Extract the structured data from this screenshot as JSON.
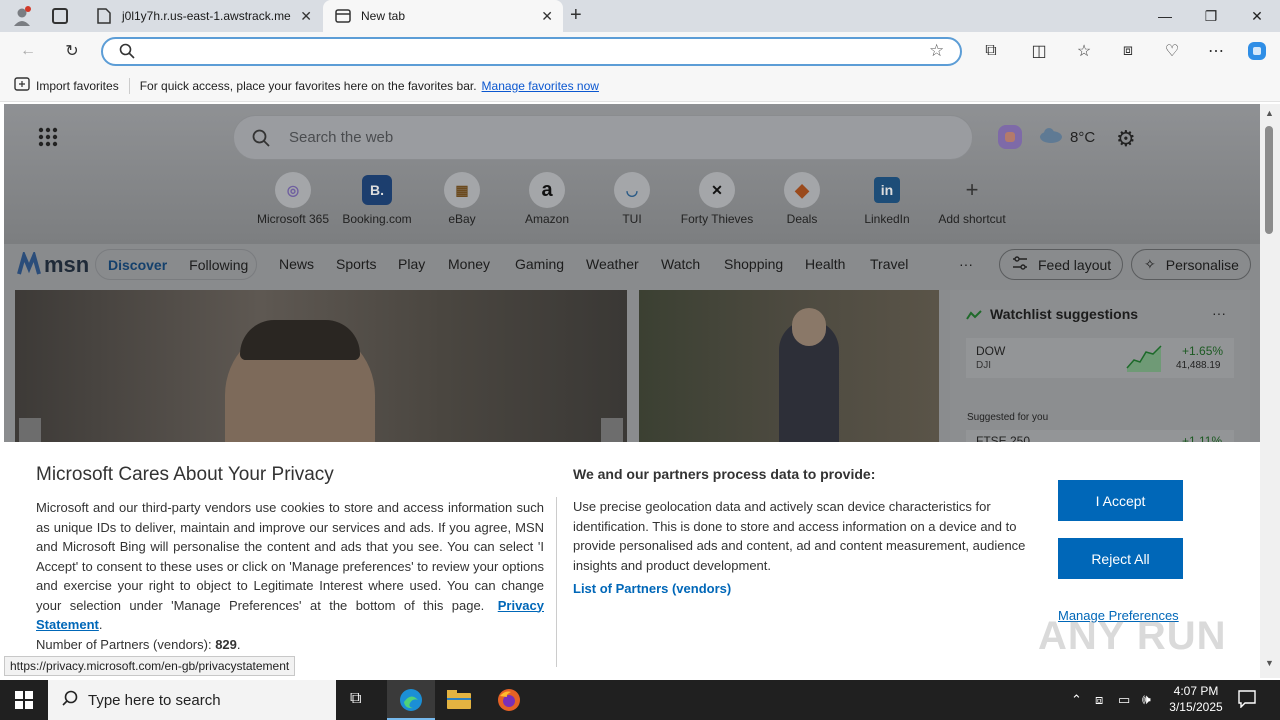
{
  "browser": {
    "tabs": [
      {
        "title": "j0l1y7h.r.us-east-1.awstrack.me",
        "active": false
      },
      {
        "title": "New tab",
        "active": true
      }
    ],
    "favorites_bar": {
      "import_label": "Import favorites",
      "message": "For quick access, place your favorites here on the favorites bar.",
      "manage_link": "Manage favorites now"
    }
  },
  "msn": {
    "search_placeholder": "Search the web",
    "weather_temp": "8°C",
    "shortcuts": [
      {
        "label": "Microsoft 365",
        "glyph": "◎"
      },
      {
        "label": "Booking.com",
        "glyph": "B."
      },
      {
        "label": "eBay",
        "glyph": "▦"
      },
      {
        "label": "Amazon",
        "glyph": "a"
      },
      {
        "label": "TUI",
        "glyph": "◡"
      },
      {
        "label": "Forty Thieves",
        "glyph": "✕"
      },
      {
        "label": "Deals",
        "glyph": "◆"
      },
      {
        "label": "LinkedIn",
        "glyph": "in"
      },
      {
        "label": "Add shortcut",
        "glyph": "+"
      }
    ],
    "logo_text": "msn",
    "nav": {
      "discover": "Discover",
      "following": "Following",
      "items": [
        "News",
        "Sports",
        "Play",
        "Money",
        "Gaming",
        "Weather",
        "Watch",
        "Shopping",
        "Health",
        "Travel"
      ],
      "more": "···",
      "feed_layout": "Feed layout",
      "personalise": "Personalise"
    },
    "watchlist": {
      "title": "Watchlist suggestions",
      "more": "···",
      "items": [
        {
          "name": "DOW",
          "symbol": "DJI",
          "change": "+1.65%",
          "value": "41,488.19"
        },
        {
          "name": "FTSE 250",
          "symbol": "",
          "change": "+1.11%",
          "value": ""
        }
      ],
      "suggested_label": "Suggested for you"
    }
  },
  "privacy": {
    "title": "Microsoft Cares About Your Privacy",
    "body": "Microsoft and our third-party vendors use cookies to store and access information such as unique IDs to deliver, maintain and improve our services and ads. If you agree, MSN and Microsoft Bing will personalise the content and ads that you see. You can select 'I Accept' to consent to these uses or click on 'Manage preferences' to review your options and exercise your right to object to Legitimate Interest where used.  You can change your selection under 'Manage Preferences' at the bottom of this page.",
    "privacy_link": "Privacy Statement",
    "partners_label": "Number of Partners (vendors):",
    "partners_count": "829",
    "purposes_title": "We and our partners process data to provide:",
    "purposes_body": "Use precise geolocation data and actively scan device characteristics for identification. This is done to store and access information on a device and to provide personalised ads and content, ad and content measurement, audience insights and product development.",
    "vendors_link": "List of Partners (vendors)",
    "accept": "I Accept",
    "reject": "Reject All",
    "manage": "Manage Preferences"
  },
  "status_url": "https://privacy.microsoft.com/en-gb/privacystatement",
  "watermark": "ANY RUN",
  "taskbar": {
    "search_placeholder": "Type here to search",
    "time": "4:07 PM",
    "date": "3/15/2025"
  }
}
